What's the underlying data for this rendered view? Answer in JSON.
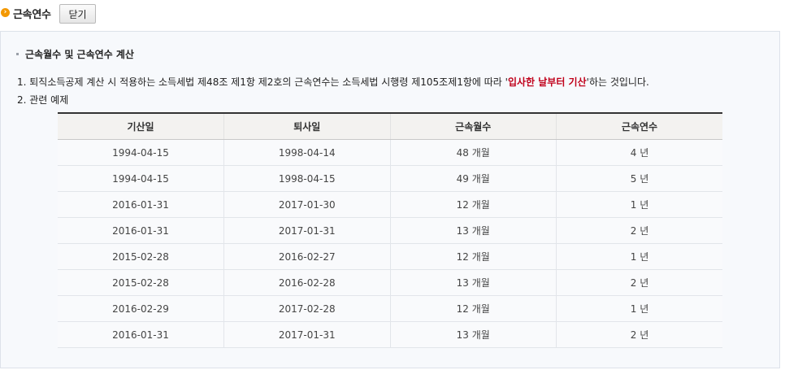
{
  "header": {
    "title": "근속연수",
    "close_label": "닫기",
    "icon": "orange-circle-arrow-icon"
  },
  "section": {
    "title": "근속월수 및 근속연수 계산"
  },
  "description": {
    "line1_prefix": "1. 퇴직소득공제 계산 시 적용하는 소득세법 제48조 제1항 제2호의 근속연수는 소득세법 시행령 제105조제1항에 따라 '",
    "line1_highlight": "입사한 날부터 기산",
    "line1_suffix": "'하는 것입니다.",
    "line2": "2. 관련 예제"
  },
  "table": {
    "headers": [
      "기산일",
      "퇴사일",
      "근속월수",
      "근속연수"
    ],
    "rows": [
      [
        "1994-04-15",
        "1998-04-14",
        "48 개월",
        "4 년"
      ],
      [
        "1994-04-15",
        "1998-04-15",
        "49 개월",
        "5 년"
      ],
      [
        "2016-01-31",
        "2017-01-30",
        "12 개월",
        "1 년"
      ],
      [
        "2016-01-31",
        "2017-01-31",
        "13 개월",
        "2 년"
      ],
      [
        "2015-02-28",
        "2016-02-27",
        "12 개월",
        "1 년"
      ],
      [
        "2015-02-28",
        "2016-02-28",
        "13 개월",
        "2 년"
      ],
      [
        "2016-02-29",
        "2017-02-28",
        "12 개월",
        "1 년"
      ],
      [
        "2016-01-31",
        "2017-01-31",
        "13 개월",
        "2 년"
      ]
    ]
  },
  "colors": {
    "accent_icon": "#f39800",
    "highlight_text": "#c0001a",
    "panel_bg": "#f7f9fc"
  }
}
